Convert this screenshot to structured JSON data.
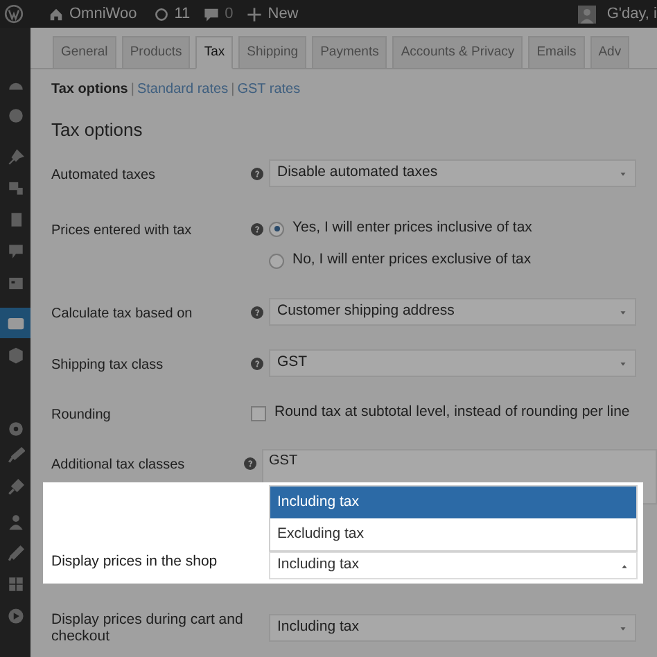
{
  "admin_bar": {
    "site": "OmniWoo",
    "updates": "11",
    "comments": "0",
    "new": "New",
    "greeting": "G'day, i"
  },
  "sidebar": {
    "items": [
      {
        "selected": false
      },
      {
        "selected": false
      },
      {
        "selected": false
      },
      {
        "selected": false
      },
      {
        "selected": false
      },
      {
        "selected": false
      },
      {
        "selected": false
      },
      {
        "selected": true
      },
      {
        "selected": false
      },
      {
        "selected": false
      },
      {
        "selected": false
      },
      {
        "selected": false
      },
      {
        "selected": false
      },
      {
        "selected": false
      },
      {
        "selected": false
      },
      {
        "selected": false
      }
    ]
  },
  "tabs": [
    {
      "label": "General",
      "selected": false
    },
    {
      "label": "Products",
      "selected": false
    },
    {
      "label": "Tax",
      "selected": true
    },
    {
      "label": "Shipping",
      "selected": false
    },
    {
      "label": "Payments",
      "selected": false
    },
    {
      "label": "Accounts & Privacy",
      "selected": false
    },
    {
      "label": "Emails",
      "selected": false
    },
    {
      "label": "Adv",
      "selected": false
    }
  ],
  "sections": [
    {
      "label": "Tax options",
      "selected": true
    },
    {
      "separator": "|",
      "label": "Standard rates",
      "selected": false
    },
    {
      "separator": "|",
      "label": "GST rates",
      "selected": false
    }
  ],
  "heading": "Tax options",
  "settings": [
    {
      "kind": "select",
      "label": "Automated taxes",
      "help": true,
      "value": "Disable automated taxes"
    },
    {
      "kind": "radio",
      "label": "Prices entered with tax",
      "help": true,
      "options": [
        {
          "label": "Yes, I will enter prices inclusive of tax",
          "selected": true
        },
        {
          "label": "No, I will enter prices exclusive of tax",
          "selected": false
        }
      ]
    },
    {
      "kind": "select",
      "label": "Calculate tax based on",
      "help": true,
      "value": "Customer shipping address"
    },
    {
      "kind": "select",
      "label": "Shipping tax class",
      "help": true,
      "value": "GST"
    },
    {
      "kind": "checkbox",
      "label": "Rounding",
      "help": false,
      "text": "Round tax at subtotal level, instead of rounding per line",
      "checked": false
    },
    {
      "kind": "textarea",
      "label": "Additional tax classes",
      "help": true,
      "value": "GST"
    }
  ],
  "highlight": {
    "label": "Display prices in the shop",
    "value": "Including tax",
    "expanded": true,
    "options": [
      {
        "label": "Including tax",
        "selected": true
      },
      {
        "label": "Excluding tax",
        "selected": false
      }
    ]
  },
  "after": {
    "label": "Display prices during cart and checkout",
    "value": "Including tax"
  }
}
